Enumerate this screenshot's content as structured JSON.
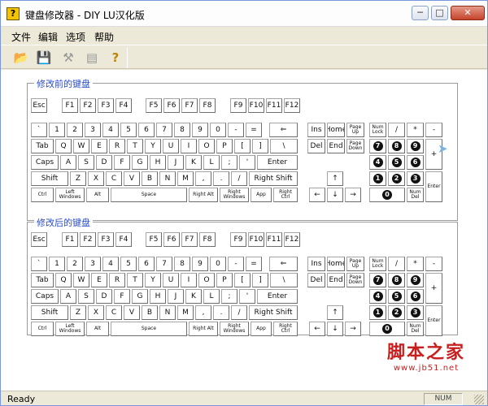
{
  "window": {
    "title": "键盘修改器 - DIY  LU汉化版",
    "app_icon_glyph": "?"
  },
  "caption_buttons": {
    "minimize": "─",
    "maximize": "□",
    "close": "✕"
  },
  "menu": [
    "文件",
    "编辑",
    "选项",
    "帮助"
  ],
  "toolbar": [
    {
      "name": "open-icon",
      "glyph": "📂"
    },
    {
      "name": "save-icon",
      "glyph": "💾"
    },
    {
      "name": "wand-icon",
      "glyph": "⚒"
    },
    {
      "name": "preview-icon",
      "glyph": "▤"
    },
    {
      "name": "help-icon",
      "glyph": "?"
    }
  ],
  "groups": {
    "before": "修改前的键盘",
    "after": "修改后的键盘"
  },
  "keyboard": {
    "function_row": [
      "Esc",
      "F1",
      "F2",
      "F3",
      "F4",
      "F5",
      "F6",
      "F7",
      "F8",
      "F9",
      "F10",
      "F11",
      "F12"
    ],
    "number_row": [
      "`",
      "1",
      "2",
      "3",
      "4",
      "5",
      "6",
      "7",
      "8",
      "9",
      "0",
      "-",
      "=",
      "⇐"
    ],
    "tab_row": [
      "Tab",
      "Q",
      "W",
      "E",
      "R",
      "T",
      "Y",
      "U",
      "I",
      "O",
      "P",
      "[",
      "]",
      "\\"
    ],
    "caps_row": [
      "Caps",
      "A",
      "S",
      "D",
      "F",
      "G",
      "H",
      "J",
      "K",
      "L",
      ";",
      "'",
      "Enter"
    ],
    "shift_row": [
      "Shift",
      "Z",
      "X",
      "C",
      "V",
      "B",
      "N",
      "M",
      ",",
      ".",
      "/",
      "Right Shift"
    ],
    "bottom_row": [
      "Ctrl",
      "Left Windows",
      "Alt",
      "Space",
      "Right Alt",
      "Right Windows",
      "App",
      "Right Ctrl"
    ],
    "edit_keys": [
      "Ins",
      "Home",
      "Page Up",
      "Del",
      "End",
      "Page Down"
    ],
    "arrow_keys": [
      "↑",
      "←",
      "↓",
      "→"
    ],
    "numpad": [
      "Num Lock",
      "/",
      "*",
      "-",
      "7",
      "8",
      "9",
      "+",
      "4",
      "5",
      "6",
      "1",
      "2",
      "3",
      "Enter",
      "0",
      "Num Del"
    ]
  },
  "watermark": {
    "title": "脚本之家",
    "url": "www.jb51.net"
  },
  "status": {
    "text": "Ready",
    "num": "NUM"
  }
}
